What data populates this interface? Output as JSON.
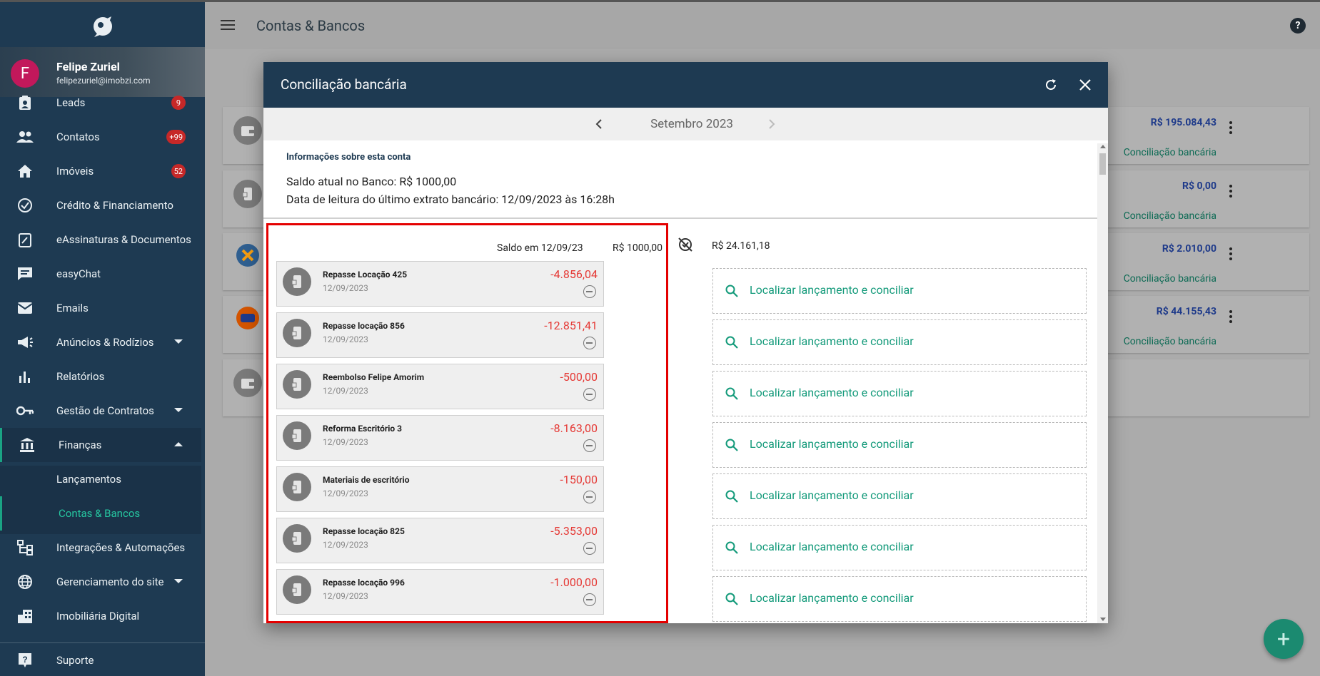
{
  "app": {
    "title": "Contas & Bancos"
  },
  "user": {
    "initial": "F",
    "name": "Felipe Zuriel",
    "email": "felipezuriel@imobzi.com"
  },
  "nav": [
    {
      "label": "Leads",
      "badge": "9",
      "icon": "clipboard-user-icon"
    },
    {
      "label": "Contatos",
      "badge": "+99",
      "icon": "people-icon"
    },
    {
      "label": "Imóveis",
      "badge": "52",
      "icon": "home-icon"
    },
    {
      "label": "Crédito & Financiamento",
      "icon": "check-circle-icon"
    },
    {
      "label": "eAssinaturas & Documentos",
      "icon": "edit-document-icon"
    },
    {
      "label": "easyChat",
      "icon": "chat-icon"
    },
    {
      "label": "Emails",
      "icon": "mail-icon"
    },
    {
      "label": "Anúncios & Rodízios",
      "icon": "megaphone-icon"
    },
    {
      "label": "Relatórios",
      "icon": "bar-chart-icon"
    },
    {
      "label": "Gestão de Contratos",
      "icon": "key-icon"
    },
    {
      "label": "Finanças",
      "icon": "bank-icon"
    },
    {
      "label": "Lançamentos"
    },
    {
      "label": "Contas & Bancos"
    },
    {
      "label": "Integrações & Automações",
      "icon": "flow-icon"
    },
    {
      "label": "Gerenciamento do site",
      "icon": "globe-icon"
    },
    {
      "label": "Imobiliária Digital",
      "icon": "building-icon"
    },
    {
      "label": "Suporte",
      "icon": "help-icon"
    }
  ],
  "background_cards": [
    {
      "value": "R$ 195.084,43",
      "link": "Conciliação bancária"
    },
    {
      "value": "R$ 0,00",
      "link": "Conciliação bancária"
    },
    {
      "value": "R$ 2.010,00",
      "link": "Conciliação bancária"
    },
    {
      "value": "R$ 44.155,43",
      "link": "Conciliação bancária"
    }
  ],
  "modal": {
    "title": "Conciliação bancária",
    "month": "Setembro 2023",
    "info_title": "Informações sobre esta conta",
    "saldo_banco": "Saldo atual no Banco: R$ 1000,00",
    "data_leitura": "Data de leitura do último extrato bancário: 12/09/2023 às 16:28h",
    "saldo_label": "Saldo em 12/09/23",
    "saldo_value": "R$ 1000,00",
    "total_right": "R$ 24.161,18",
    "find_label": "Localizar lançamento e conciliar",
    "transactions": [
      {
        "name": "Repasse Locação 425",
        "date": "12/09/2023",
        "value": "-4.856,04"
      },
      {
        "name": "Repasse locação 856",
        "date": "12/09/2023",
        "value": "-12.851,41"
      },
      {
        "name": "Reembolso Felipe Amorim",
        "date": "12/09/2023",
        "value": "-500,00"
      },
      {
        "name": "Reforma Escritório 3",
        "date": "12/09/2023",
        "value": "-8.163,00"
      },
      {
        "name": "Materiais de escritório",
        "date": "12/09/2023",
        "value": "-150,00"
      },
      {
        "name": "Repasse locação 825",
        "date": "12/09/2023",
        "value": "-5.353,00"
      },
      {
        "name": "Repasse locação 996",
        "date": "12/09/2023",
        "value": "-1.000,00"
      }
    ]
  }
}
